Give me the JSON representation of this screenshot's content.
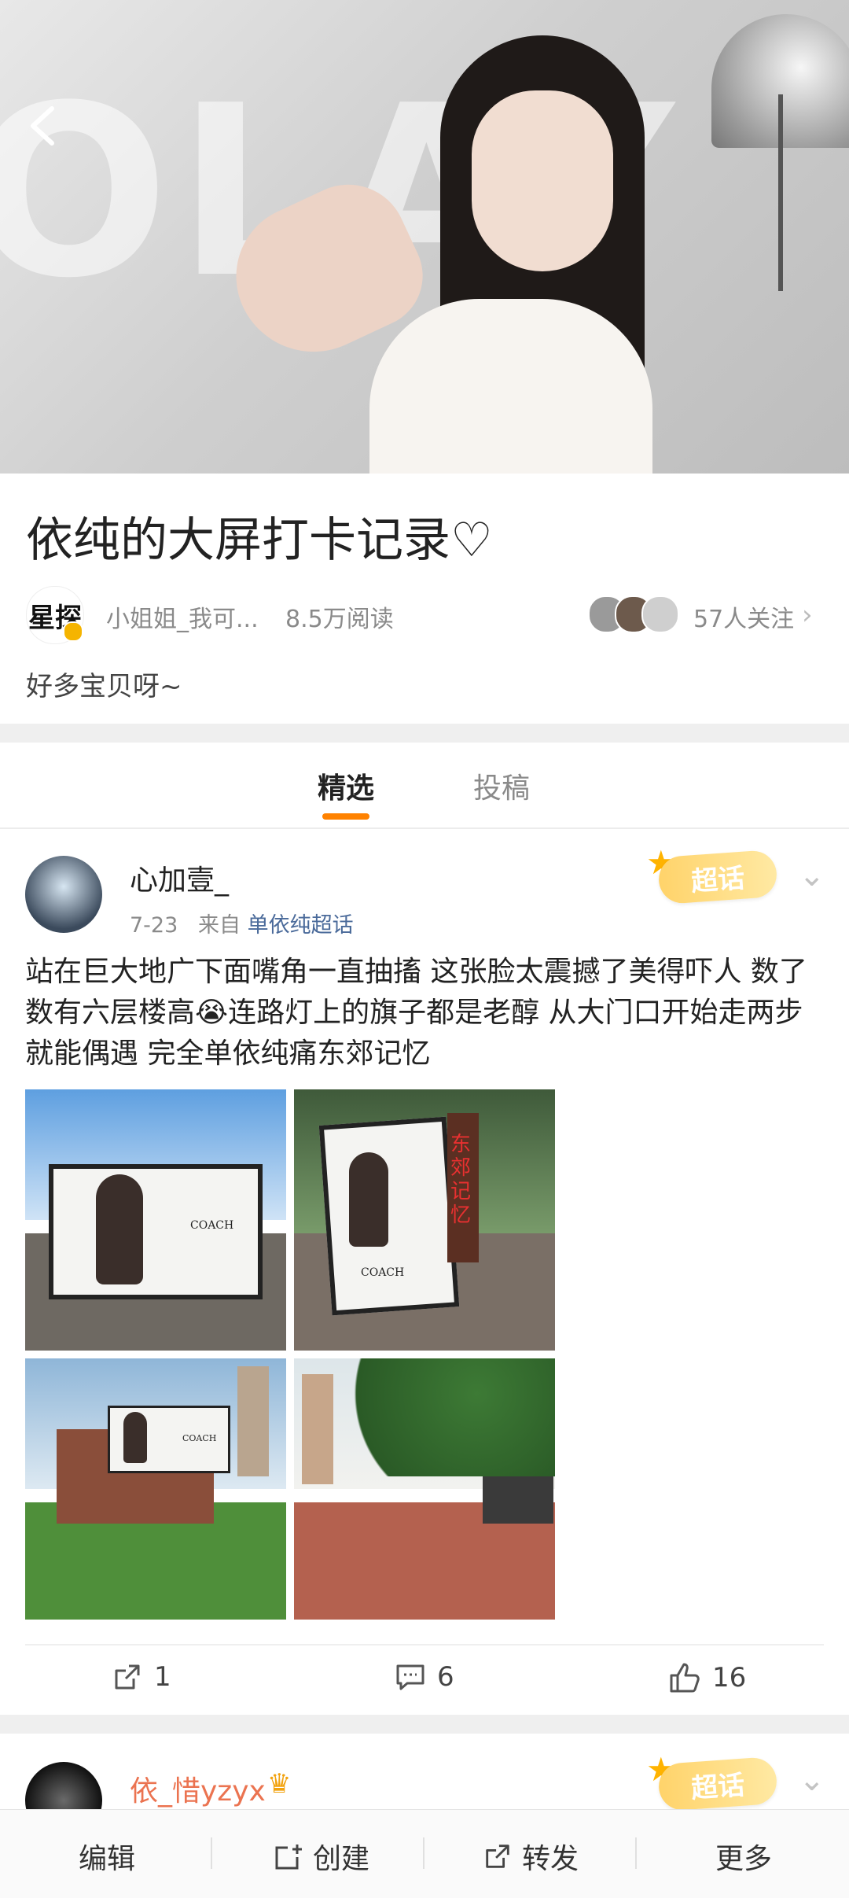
{
  "topic": {
    "title": "依纯的大屏打卡记录♡",
    "host_avatar_text": "星探",
    "host_name": "小姐姐_我可...",
    "reads": "8.5万阅读",
    "followers": "57人关注",
    "description": "好多宝贝呀~"
  },
  "tabs": [
    {
      "label": "精选",
      "active": true
    },
    {
      "label": "投稿",
      "active": false
    }
  ],
  "post": {
    "username": "心加壹_",
    "date": "7-23",
    "source_prefix": "来自",
    "source": "单依纯超话",
    "badge": "超话",
    "text": "站在巨大地广下面嘴角一直抽搐 这张脸太震撼了美得吓人 数了数有六层楼高😭连路灯上的旗子都是老醇 从大门口开始走两步就能偶遇 完全单依纯痛东郊记忆",
    "photo_texts": {
      "coach_1": "COACH",
      "coach_2": "COACH",
      "coach_3": "COACH",
      "sign": "东郊记忆"
    },
    "reposts": "1",
    "comments": "6",
    "likes": "16"
  },
  "next_post": {
    "username": "依_惜yzyx",
    "badge": "超话"
  },
  "bottom_bar": {
    "edit": "编辑",
    "create": "创建",
    "repost": "转发",
    "more": "更多"
  },
  "colors": {
    "accent": "#ff8200",
    "link": "#4a6a9a",
    "username_highlight": "#eb7350",
    "badge_gold": "#ffd36a"
  }
}
